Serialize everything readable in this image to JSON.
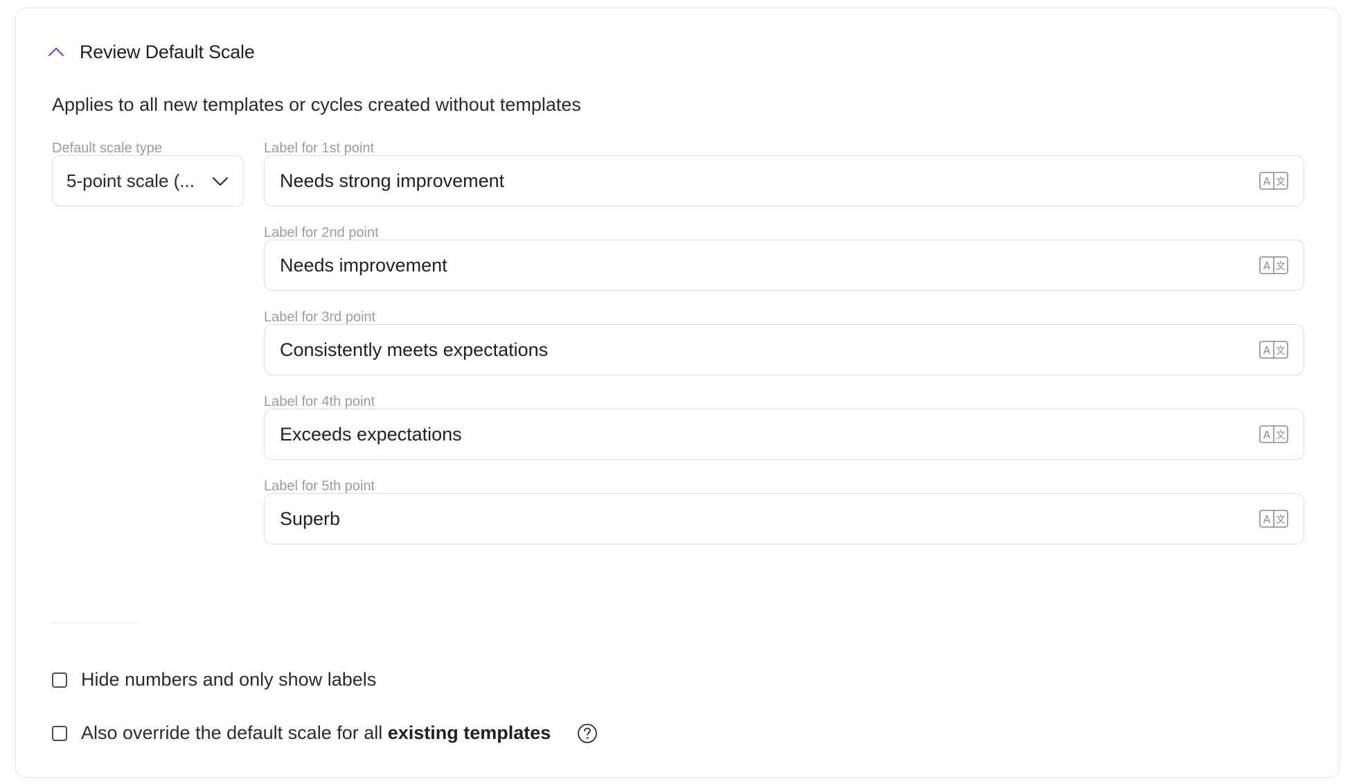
{
  "section": {
    "title": "Review Default Scale",
    "subtitle": "Applies to all new templates or cycles created without templates"
  },
  "scale_type": {
    "label": "Default scale type",
    "value": "5-point scale (..."
  },
  "point_labels": [
    {
      "label": "Label for 1st point",
      "value": "Needs strong improvement"
    },
    {
      "label": "Label for 2nd point",
      "value": "Needs improvement"
    },
    {
      "label": "Label for 3rd point",
      "value": "Consistently meets expectations"
    },
    {
      "label": "Label for 4th point",
      "value": "Exceeds expectations"
    },
    {
      "label": "Label for 5th point",
      "value": "Superb"
    }
  ],
  "options": {
    "hide_numbers": "Hide numbers and only show labels",
    "override_prefix": "Also override the default scale for all",
    "override_bold": "existing templates"
  },
  "icons": {
    "collapse": "chevron-up-icon",
    "dropdown": "chevron-down-icon",
    "translate": "translate-icon",
    "help": "help-circle-icon"
  },
  "colors": {
    "accent": "#5b4fd6",
    "border": "#dcdce2",
    "muted_text": "#9b9ba3"
  }
}
